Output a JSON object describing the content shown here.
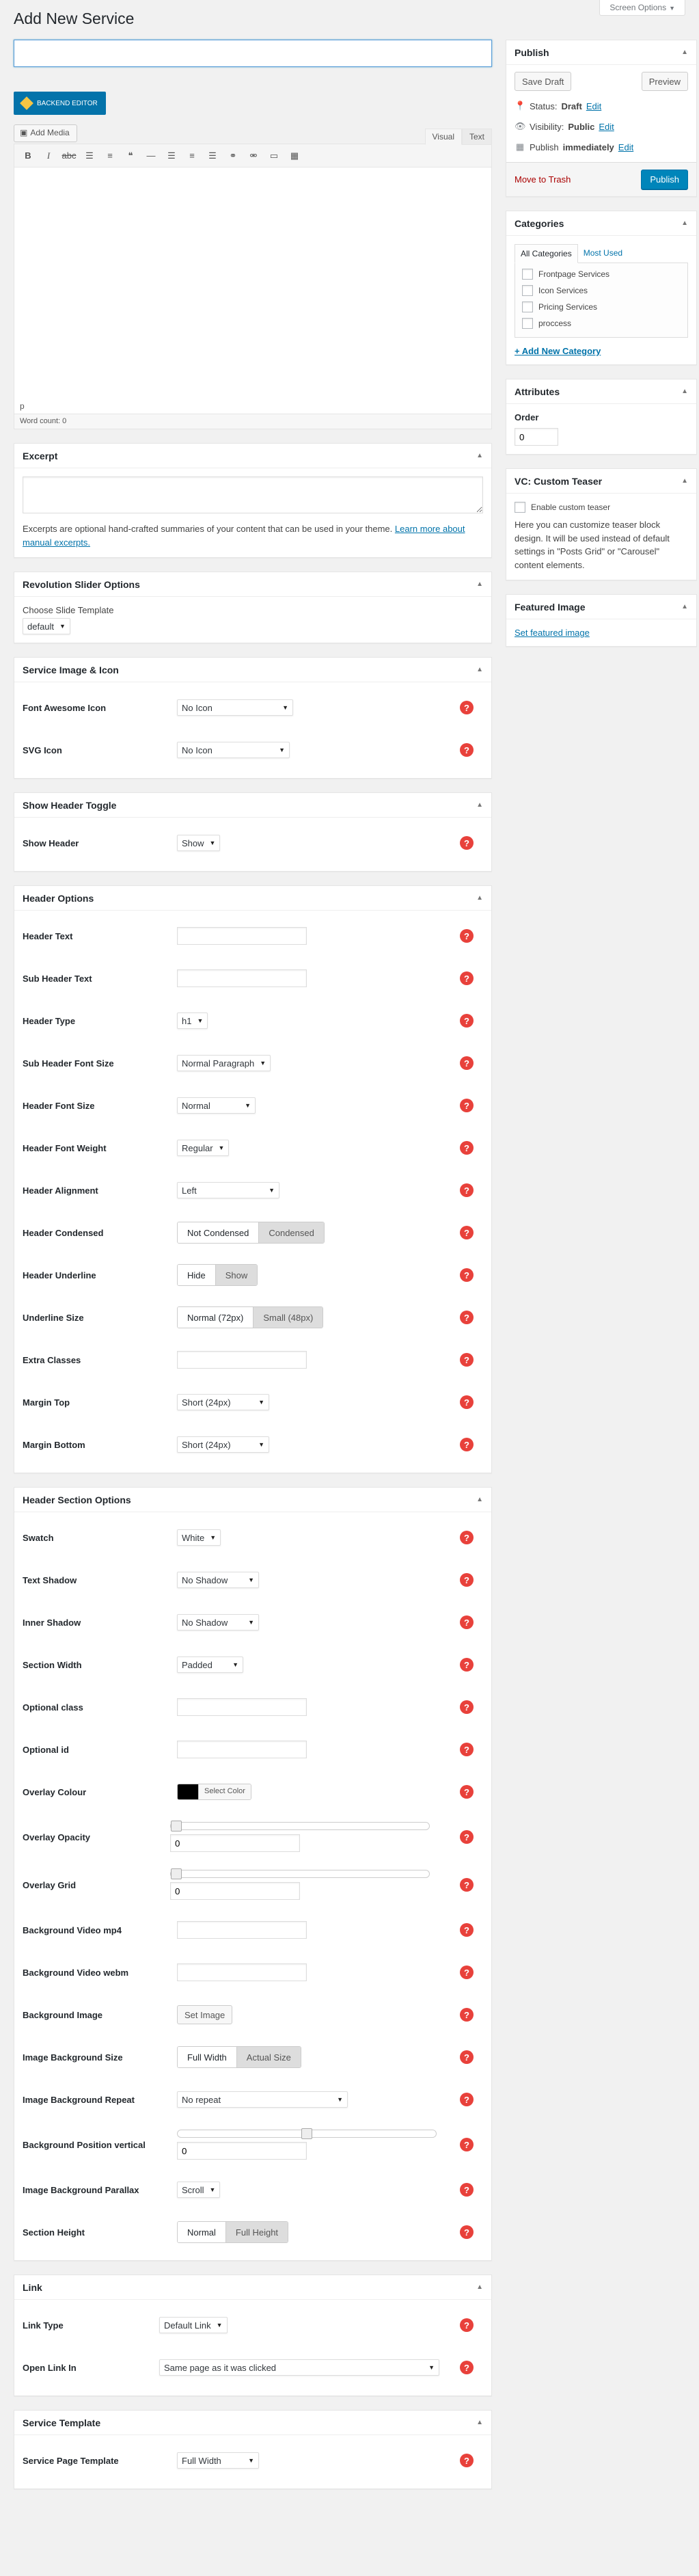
{
  "screen_options": "Screen Options",
  "page_title": "Add New Service",
  "editor": {
    "title_value": "",
    "backend_editor": "BACKEND EDITOR",
    "add_media": "Add Media",
    "tab_visual": "Visual",
    "tab_text": "Text",
    "toolbar_icons": [
      "bold-icon",
      "italic-icon",
      "strikethrough-icon",
      "bullet-list-icon",
      "numbered-list-icon",
      "blockquote-icon",
      "horizontal-rule-icon",
      "align-left-icon",
      "align-center-icon",
      "align-right-icon",
      "insert-link-icon",
      "remove-link-icon",
      "read-more-icon",
      "toolbar-toggle-icon"
    ],
    "path": "p",
    "word_count": "Word count: 0"
  },
  "excerpt": {
    "title": "Excerpt",
    "help": "Excerpts are optional hand-crafted summaries of your content that can be used in your theme.",
    "link": "Learn more about manual excerpts."
  },
  "rev_slider": {
    "title": "Revolution Slider Options",
    "label": "Choose Slide Template",
    "value": "default"
  },
  "service_image": {
    "title": "Service Image & Icon",
    "font_awesome_label": "Font Awesome Icon",
    "font_awesome_value": "No Icon",
    "svg_label": "SVG Icon",
    "svg_value": "No Icon"
  },
  "header_toggle": {
    "title": "Show Header Toggle",
    "show_label": "Show Header",
    "show_value": "Show"
  },
  "header_options": {
    "title": "Header Options",
    "header_text": "Header Text",
    "sub_header_text": "Sub Header Text",
    "header_type": "Header Type",
    "header_type_value": "h1",
    "sub_header_font_size": "Sub Header Font Size",
    "sub_header_font_size_value": "Normal Paragraph",
    "header_font_size": "Header Font Size",
    "header_font_size_value": "Normal",
    "header_font_weight": "Header Font Weight",
    "header_font_weight_value": "Regular",
    "header_alignment": "Header Alignment",
    "header_alignment_value": "Left",
    "header_condensed": "Header Condensed",
    "header_condensed_options": [
      "Not Condensed",
      "Condensed"
    ],
    "header_underline": "Header Underline",
    "header_underline_options": [
      "Hide",
      "Show"
    ],
    "underline_size": "Underline Size",
    "underline_size_options": [
      "Normal (72px)",
      "Small (48px)"
    ],
    "extra_classes": "Extra Classes",
    "margin_top": "Margin Top",
    "margin_top_value": "Short (24px)",
    "margin_bottom": "Margin Bottom",
    "margin_bottom_value": "Short (24px)"
  },
  "header_section": {
    "title": "Header Section Options",
    "swatch": "Swatch",
    "swatch_value": "White",
    "text_shadow": "Text Shadow",
    "text_shadow_value": "No Shadow",
    "inner_shadow": "Inner Shadow",
    "inner_shadow_value": "No Shadow",
    "section_width": "Section Width",
    "section_width_value": "Padded",
    "optional_class": "Optional class",
    "optional_id": "Optional id",
    "overlay_colour": "Overlay Colour",
    "overlay_colour_value": "#000000",
    "select_color": "Select Color",
    "overlay_opacity": "Overlay Opacity",
    "overlay_opacity_value": "0",
    "overlay_opacity_fraction": 0,
    "overlay_grid": "Overlay Grid",
    "overlay_grid_value": "0",
    "overlay_grid_fraction": 0,
    "bg_video_mp4": "Background Video mp4",
    "bg_video_webm": "Background Video webm",
    "bg_image": "Background Image",
    "set_image": "Set Image",
    "image_bg_size": "Image Background Size",
    "image_bg_size_options": [
      "Full Width",
      "Actual Size"
    ],
    "image_bg_repeat": "Image Background Repeat",
    "image_bg_repeat_value": "No repeat",
    "bg_position_vertical": "Background Position vertical",
    "bg_position_vertical_value": "0",
    "bg_position_vertical_fraction": 0.5,
    "image_bg_parallax": "Image Background Parallax",
    "image_bg_parallax_value": "Scroll",
    "section_height": "Section Height",
    "section_height_options": [
      "Normal",
      "Full Height"
    ]
  },
  "link_box": {
    "title": "Link",
    "link_type": "Link Type",
    "link_type_value": "Default Link",
    "open_link_in": "Open Link In",
    "open_link_in_value": "Same page as it was clicked"
  },
  "service_template": {
    "title": "Service Template",
    "page_template": "Service Page Template",
    "page_template_value": "Full Width"
  },
  "publish": {
    "title": "Publish",
    "save_draft": "Save Draft",
    "preview": "Preview",
    "status_label": "Status:",
    "status_value": "Draft",
    "edit": "Edit",
    "visibility_label": "Visibility:",
    "visibility_value": "Public",
    "publish_label": "Publish",
    "publish_value": "immediately",
    "move_to_trash": "Move to Trash",
    "publish_button": "Publish"
  },
  "categories": {
    "title": "Categories",
    "tab_all": "All Categories",
    "tab_most_used": "Most Used",
    "items": [
      "Frontpage Services",
      "Icon Services",
      "Pricing Services",
      "proccess"
    ],
    "add_new": "+ Add New Category"
  },
  "attributes": {
    "title": "Attributes",
    "order_label": "Order",
    "order_value": "0"
  },
  "vc_teaser": {
    "title": "VC: Custom Teaser",
    "checkbox_label": "Enable custom teaser",
    "help": "Here you can customize teaser block design. It will be used instead of default settings in \"Posts Grid\" or \"Carousel\" content elements."
  },
  "featured_image": {
    "title": "Featured Image",
    "link": "Set featured image"
  },
  "colors": {
    "accent": "#0073aa",
    "publish_button": "#0085ba",
    "help_dot": "#e8413b",
    "trash": "#aa0000"
  }
}
